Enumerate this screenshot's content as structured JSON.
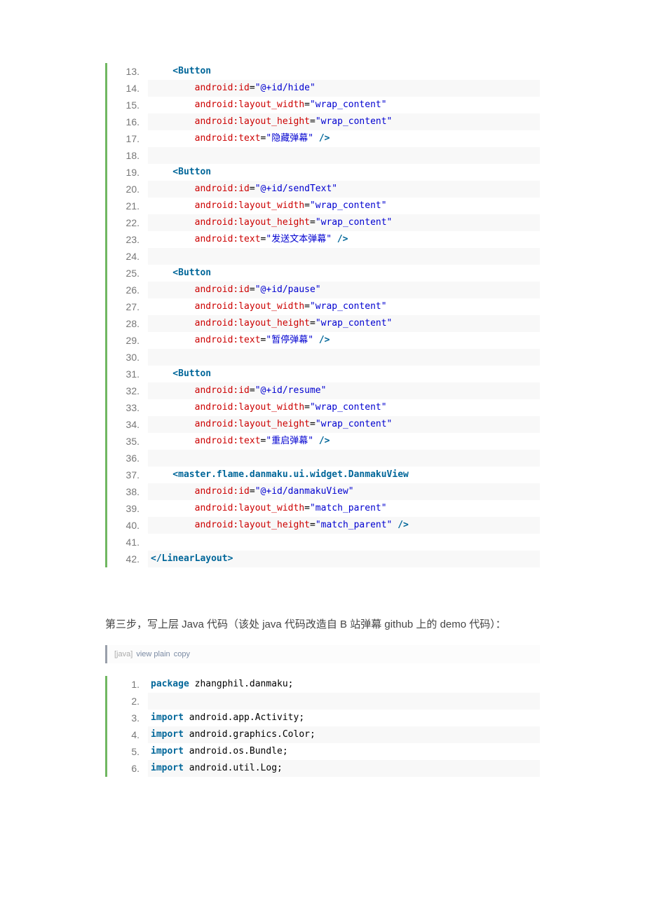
{
  "block1_start": 13,
  "block1": [
    [
      [
        "tag",
        "    <Button"
      ]
    ],
    [
      [
        "attr",
        "        android:id"
      ],
      [
        "eq",
        "="
      ],
      [
        "val",
        "\"@+id/hide\""
      ]
    ],
    [
      [
        "attr",
        "        android:layout_width"
      ],
      [
        "eq",
        "="
      ],
      [
        "val",
        "\"wrap_content\""
      ]
    ],
    [
      [
        "attr",
        "        android:layout_height"
      ],
      [
        "eq",
        "="
      ],
      [
        "val",
        "\"wrap_content\""
      ]
    ],
    [
      [
        "attr",
        "        android:text"
      ],
      [
        "eq",
        "="
      ],
      [
        "val",
        "\"隐藏弹幕\""
      ],
      [
        "tag",
        " />"
      ]
    ],
    [],
    [
      [
        "tag",
        "    <Button"
      ]
    ],
    [
      [
        "attr",
        "        android:id"
      ],
      [
        "eq",
        "="
      ],
      [
        "val",
        "\"@+id/sendText\""
      ]
    ],
    [
      [
        "attr",
        "        android:layout_width"
      ],
      [
        "eq",
        "="
      ],
      [
        "val",
        "\"wrap_content\""
      ]
    ],
    [
      [
        "attr",
        "        android:layout_height"
      ],
      [
        "eq",
        "="
      ],
      [
        "val",
        "\"wrap_content\""
      ]
    ],
    [
      [
        "attr",
        "        android:text"
      ],
      [
        "eq",
        "="
      ],
      [
        "val",
        "\"发送文本弹幕\""
      ],
      [
        "tag",
        " />"
      ]
    ],
    [],
    [
      [
        "tag",
        "    <Button"
      ]
    ],
    [
      [
        "attr",
        "        android:id"
      ],
      [
        "eq",
        "="
      ],
      [
        "val",
        "\"@+id/pause\""
      ]
    ],
    [
      [
        "attr",
        "        android:layout_width"
      ],
      [
        "eq",
        "="
      ],
      [
        "val",
        "\"wrap_content\""
      ]
    ],
    [
      [
        "attr",
        "        android:layout_height"
      ],
      [
        "eq",
        "="
      ],
      [
        "val",
        "\"wrap_content\""
      ]
    ],
    [
      [
        "attr",
        "        android:text"
      ],
      [
        "eq",
        "="
      ],
      [
        "val",
        "\"暂停弹幕\""
      ],
      [
        "tag",
        " />"
      ]
    ],
    [],
    [
      [
        "tag",
        "    <Button"
      ]
    ],
    [
      [
        "attr",
        "        android:id"
      ],
      [
        "eq",
        "="
      ],
      [
        "val",
        "\"@+id/resume\""
      ]
    ],
    [
      [
        "attr",
        "        android:layout_width"
      ],
      [
        "eq",
        "="
      ],
      [
        "val",
        "\"wrap_content\""
      ]
    ],
    [
      [
        "attr",
        "        android:layout_height"
      ],
      [
        "eq",
        "="
      ],
      [
        "val",
        "\"wrap_content\""
      ]
    ],
    [
      [
        "attr",
        "        android:text"
      ],
      [
        "eq",
        "="
      ],
      [
        "val",
        "\"重启弹幕\""
      ],
      [
        "tag",
        " />"
      ]
    ],
    [],
    [
      [
        "tag",
        "    <master.flame.danmaku.ui.widget.DanmakuView"
      ]
    ],
    [
      [
        "attr",
        "        android:id"
      ],
      [
        "eq",
        "="
      ],
      [
        "val",
        "\"@+id/danmakuView\""
      ]
    ],
    [
      [
        "attr",
        "        android:layout_width"
      ],
      [
        "eq",
        "="
      ],
      [
        "val",
        "\"match_parent\""
      ]
    ],
    [
      [
        "attr",
        "        android:layout_height"
      ],
      [
        "eq",
        "="
      ],
      [
        "val",
        "\"match_parent\""
      ],
      [
        "tag",
        " />"
      ]
    ],
    [],
    [
      [
        "tag",
        "</LinearLayout>"
      ]
    ]
  ],
  "paragraph": "第三步，写上层 Java 代码（该处 java 代码改造自 B 站弹幕 github 上的 demo 代码）：",
  "meta_label": "[java]",
  "meta_link1": "view plain",
  "meta_link2": "copy",
  "block2_start": 1,
  "block2": [
    [
      [
        "kw",
        "package"
      ],
      [
        "pkg",
        " zhangphil.danmaku;"
      ]
    ],
    [],
    [
      [
        "kw",
        "import"
      ],
      [
        "pkg",
        " android.app.Activity;"
      ]
    ],
    [
      [
        "kw",
        "import"
      ],
      [
        "pkg",
        " android.graphics.Color;"
      ]
    ],
    [
      [
        "kw",
        "import"
      ],
      [
        "pkg",
        " android.os.Bundle;"
      ]
    ],
    [
      [
        "kw",
        "import"
      ],
      [
        "pkg",
        " android.util.Log;"
      ]
    ]
  ]
}
